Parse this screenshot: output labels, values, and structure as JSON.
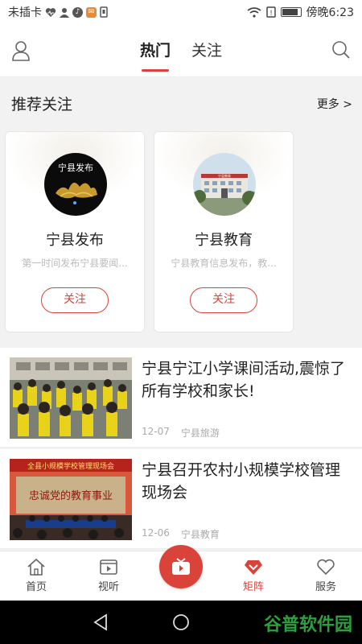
{
  "status_bar": {
    "carrier": "未插卡",
    "time": "傍晚6:23"
  },
  "top_nav": {
    "tabs": [
      {
        "label": "热门",
        "active": true
      },
      {
        "label": "关注",
        "active": false
      }
    ]
  },
  "recommend": {
    "title": "推荐关注",
    "more": "更多 >",
    "cards": [
      {
        "name": "宁县发布",
        "desc": "第一时间发布宁县要闻...",
        "follow": "关注",
        "avatar_text": "宁县发布"
      },
      {
        "name": "宁县教育",
        "desc": "宁县教育信息发布，教...",
        "follow": "关注",
        "avatar_text": "宁县教育"
      }
    ]
  },
  "news": [
    {
      "title": "宁县宁江小学课间活动,震惊了所有学校和家长!",
      "date": "12-07",
      "source": "宁县旅游"
    },
    {
      "title": "宁县召开农村小规模学校管理现场会",
      "date": "12-06",
      "source": "宁县教育",
      "banner": "全县小规模学校管理现场会",
      "slogan": "忠诚党的教育事业"
    }
  ],
  "bottom_nav": {
    "items": [
      {
        "label": "首页",
        "icon": "home-icon"
      },
      {
        "label": "视听",
        "icon": "video-icon"
      },
      {
        "label": "矩阵",
        "icon": "matrix-icon",
        "active": true
      },
      {
        "label": "服务",
        "icon": "heart-icon"
      }
    ]
  },
  "watermark": "谷普软件园",
  "colors": {
    "accent": "#d9433a",
    "watermark": "#2e9e3e"
  }
}
